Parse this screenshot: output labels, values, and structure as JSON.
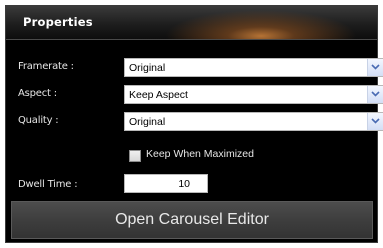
{
  "panel": {
    "title": "Properties"
  },
  "framerate": {
    "label": "Framerate :",
    "value": "Original"
  },
  "aspect": {
    "label": "Aspect :",
    "value": "Keep Aspect"
  },
  "quality": {
    "label": "Quality :",
    "value": "Original"
  },
  "keep_when_maximized": {
    "label": "Keep When Maximized",
    "checked": false
  },
  "dwell_time": {
    "label": "Dwell Time :",
    "value": "10"
  },
  "carousel_button": {
    "label": "Open Carousel Editor"
  },
  "icons": {
    "dropdown_arrow": "chevron-down-icon"
  },
  "colors": {
    "background": "#000000",
    "header_accent": "#be7837",
    "button_background": "#3e3e3e",
    "text": "#e6e6e6"
  }
}
